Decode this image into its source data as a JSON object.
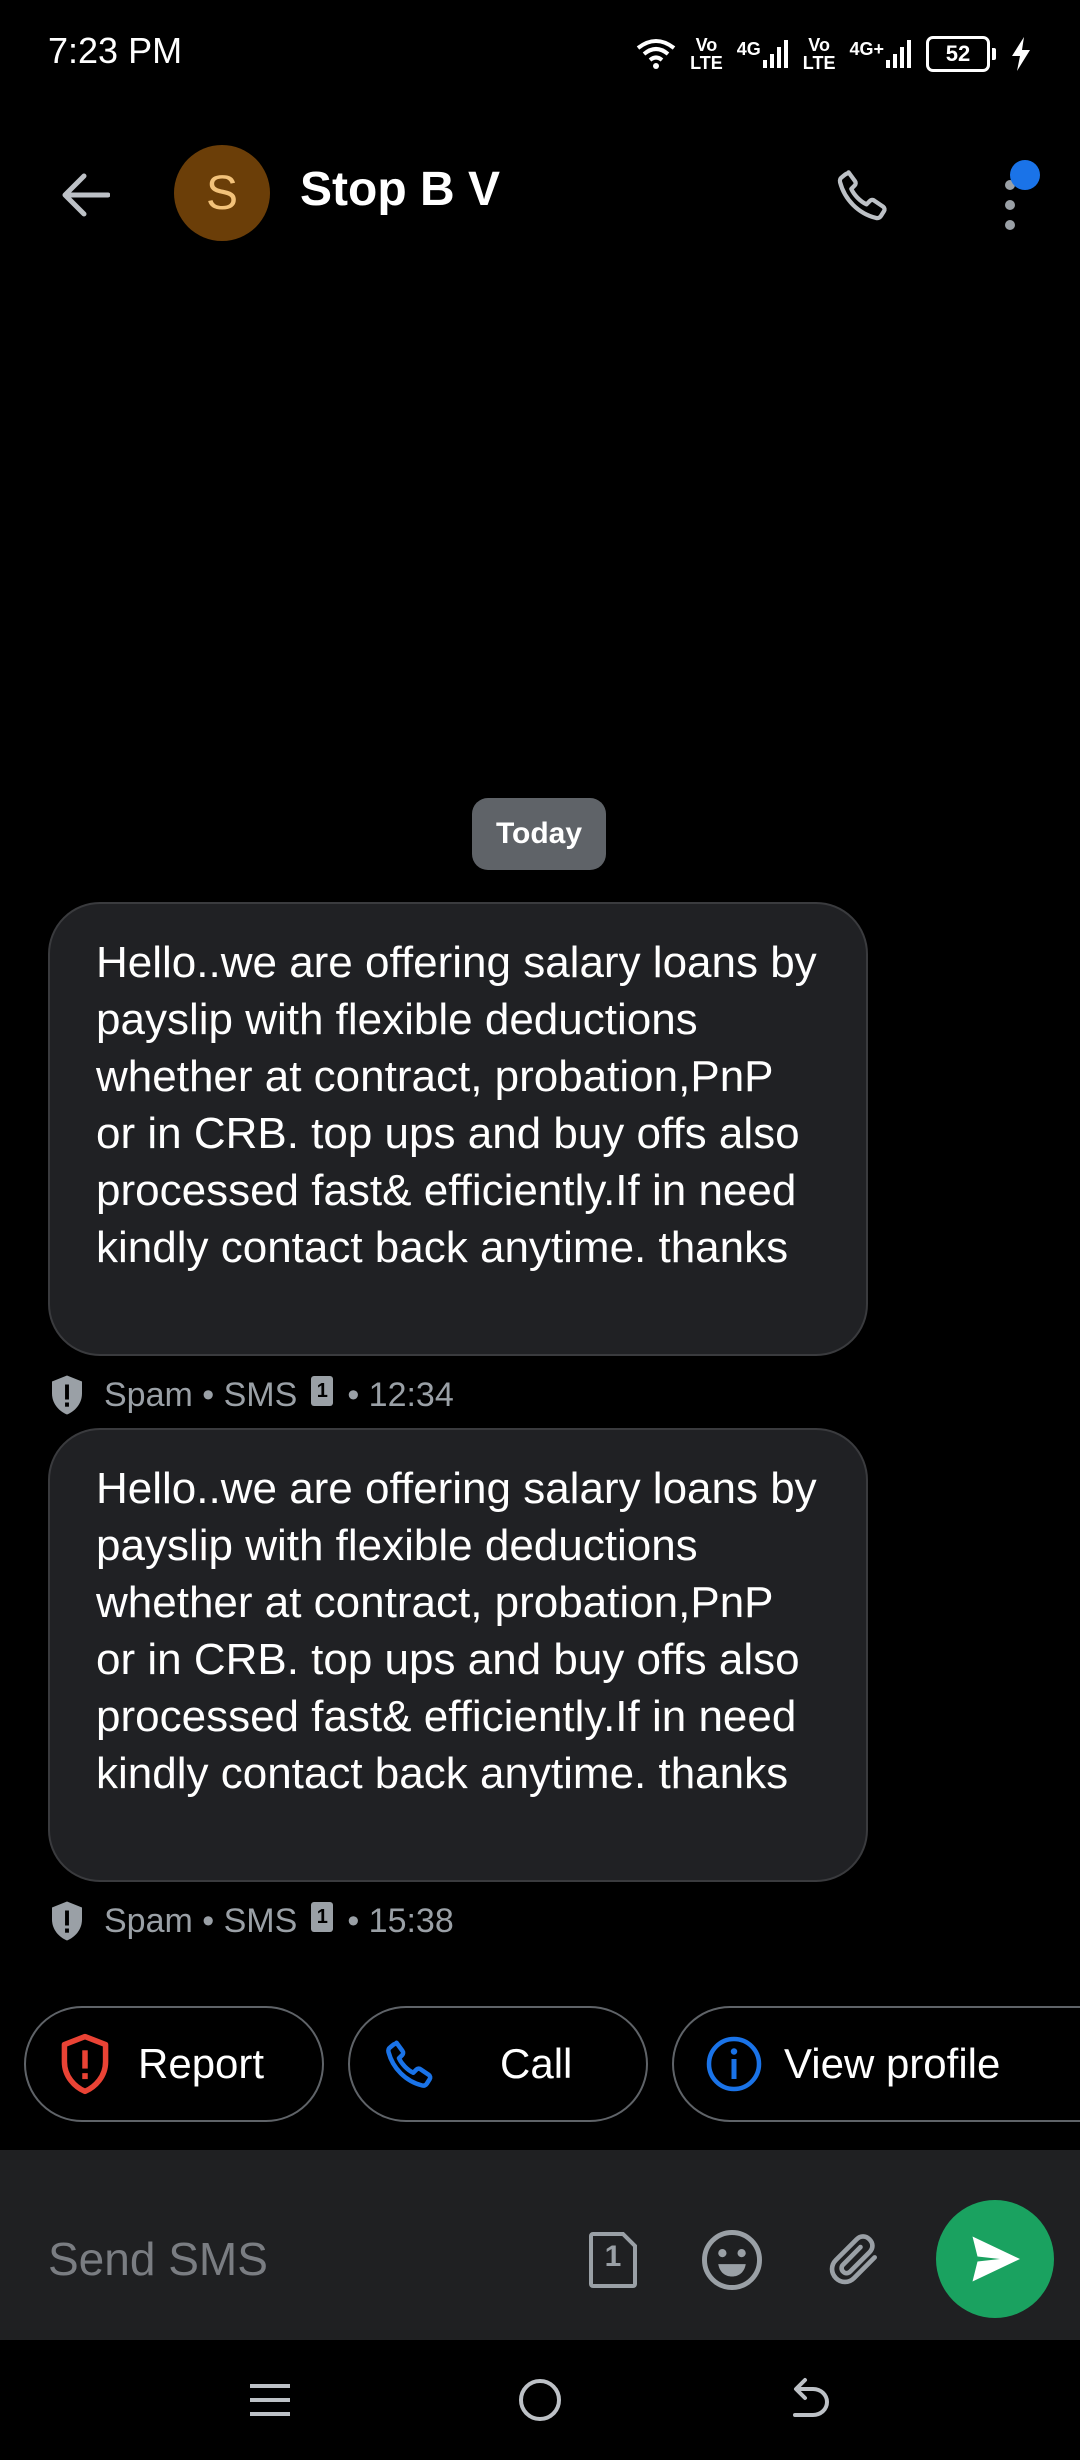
{
  "status_bar": {
    "time": "7:23 PM",
    "sim1_label_top": "Vo",
    "sim1_label_bottom": "LTE",
    "sim1_network": "4G",
    "sim2_label_top": "Vo",
    "sim2_label_bottom": "LTE",
    "sim2_network": "4G+",
    "battery": "52"
  },
  "header": {
    "avatar_letter": "S",
    "contact_name": "Stop B V"
  },
  "conversation": {
    "date_label": "Today",
    "messages": [
      {
        "text": "Hello..we are offering salary loans by payslip with flexible deductions whether at contract, probation,PnP or in CRB. top ups and buy offs also processed fast& efficiently.If in need kindly contact back anytime. thanks",
        "label": "Spam",
        "channel": "SMS",
        "sim": "1",
        "time": "12:34"
      },
      {
        "text": "Hello..we are offering salary loans by payslip with flexible deductions whether at contract, probation,PnP or in CRB. top ups and buy offs also processed fast& efficiently.If in need kindly contact back anytime. thanks",
        "label": "Spam",
        "channel": "SMS",
        "sim": "1",
        "time": "15:38"
      }
    ]
  },
  "actions": {
    "report": "Report",
    "call": "Call",
    "view_profile": "View profile"
  },
  "composer": {
    "placeholder": "Send SMS",
    "sim": "1"
  },
  "colors": {
    "background": "#000000",
    "bubble": "#202124",
    "avatar": "#6b3e08",
    "send_button": "#1aa260",
    "report_icon": "#ea4335",
    "action_icon": "#1a73e8",
    "notification_dot": "#1a73e8"
  }
}
